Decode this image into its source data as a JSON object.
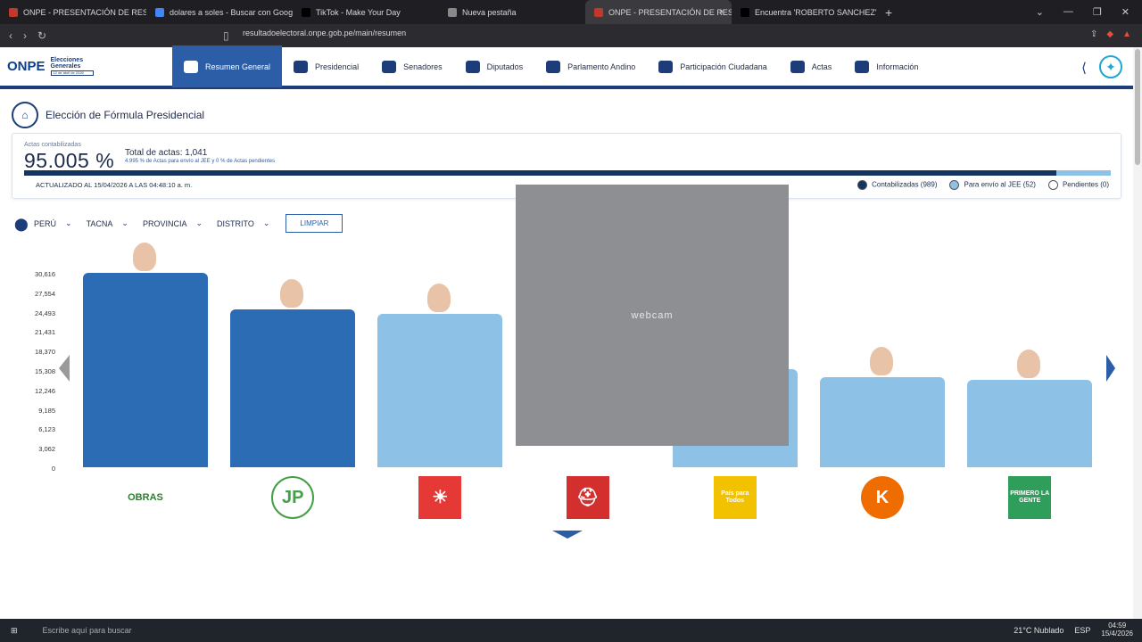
{
  "browser": {
    "tabs": [
      {
        "title": "ONPE - PRESENTACIÓN DE RESULTADOS",
        "active": false,
        "fav": "#c0392b"
      },
      {
        "title": "dolares a soles - Buscar con Google",
        "active": false,
        "fav": "#4285f4"
      },
      {
        "title": "TikTok - Make Your Day",
        "active": false,
        "fav": "#000000"
      },
      {
        "title": "Nueva pestaña",
        "active": false,
        "fav": "#888888"
      },
      {
        "title": "ONPE - PRESENTACIÓN DE RESULTADOS",
        "active": true,
        "fav": "#c0392b"
      },
      {
        "title": "Encuentra 'ROBERTO SANCHEZ' en TikTok",
        "active": false,
        "fav": "#000000"
      }
    ],
    "url": "resultadoelectoral.onpe.gob.pe/main/resumen"
  },
  "nav": {
    "brand": "ONPE",
    "event": "Elecciones Generales",
    "date": "12 de abril de 2026",
    "items": [
      {
        "label": "Resumen General",
        "active": true
      },
      {
        "label": "Presidencial",
        "active": false
      },
      {
        "label": "Senadores",
        "active": false
      },
      {
        "label": "Diputados",
        "active": false
      },
      {
        "label": "Parlamento Andino",
        "active": false
      },
      {
        "label": "Participación Ciudadana",
        "active": false
      },
      {
        "label": "Actas",
        "active": false
      },
      {
        "label": "Información",
        "active": false
      }
    ]
  },
  "page": {
    "title": "Elección de Fórmula Presidencial"
  },
  "summary": {
    "pct_label": "Actas contabilizadas",
    "pct_value": "95.005 %",
    "total_label": "Total de actas: 1,041",
    "sub_text": "4.995 % de Actas para envío al JEE y 0 % de Actas pendientes",
    "counted_fraction": 0.95005,
    "jee_fraction": 0.04995,
    "updated": "ACTUALIZADO AL 15/04/2026 A LAS 04:48:10 a. m.",
    "legend": [
      {
        "label": "Contabilizadas (989)",
        "color": "#13355f"
      },
      {
        "label": "Para envío al JEE (52)",
        "color": "#8ec1e6"
      },
      {
        "label": "Pendientes (0)",
        "color": "#ffffff"
      }
    ]
  },
  "filters": {
    "items": [
      "PERÚ",
      "TACNA",
      "PROVINCIA",
      "DISTRITO"
    ],
    "clear": "LIMPIAR"
  },
  "chart_data": {
    "type": "bar",
    "yticks": [
      "30,616",
      "27,554",
      "24,493",
      "21,431",
      "18,370",
      "15,308",
      "12,246",
      "9,185",
      "6,123",
      "3,062",
      "0"
    ],
    "ylim": [
      0,
      30616
    ],
    "bars": [
      {
        "party": "OBRAS",
        "value": 30616,
        "color": "#2b6cb4",
        "logo_color": "#2e7d32",
        "logo_text": "OBRAS"
      },
      {
        "party": "JP",
        "value": 24900,
        "color": "#2b6cb4",
        "logo_color": "#43a047",
        "logo_text": "JP"
      },
      {
        "party": "sun",
        "value": 24100,
        "color": "#8ec1e6",
        "logo_color": "#e53935",
        "logo_text": "☀"
      },
      {
        "party": "helmet",
        "value": 0,
        "color": "#8ec1e6",
        "logo_color": "#d32f2f",
        "logo_text": "⛑"
      },
      {
        "party": "País para Todos",
        "value": 15500,
        "color": "#8ec1e6",
        "logo_color": "#f2c100",
        "logo_text": "País para Todos"
      },
      {
        "party": "K",
        "value": 14200,
        "color": "#8ec1e6",
        "logo_color": "#ef6c00",
        "logo_text": "K"
      },
      {
        "party": "PRIMERO LA GENTE",
        "value": 13800,
        "color": "#8ec1e6",
        "logo_color": "#2e9e5a",
        "logo_text": "PRIMERO LA GENTE"
      }
    ]
  },
  "overlay": {
    "camera": "webcam"
  },
  "taskbar": {
    "search": "Escribe aquí para buscar",
    "weather": "21°C  Nublado",
    "lang": "ESP",
    "time": "04:59",
    "date": "15/4/2026"
  }
}
